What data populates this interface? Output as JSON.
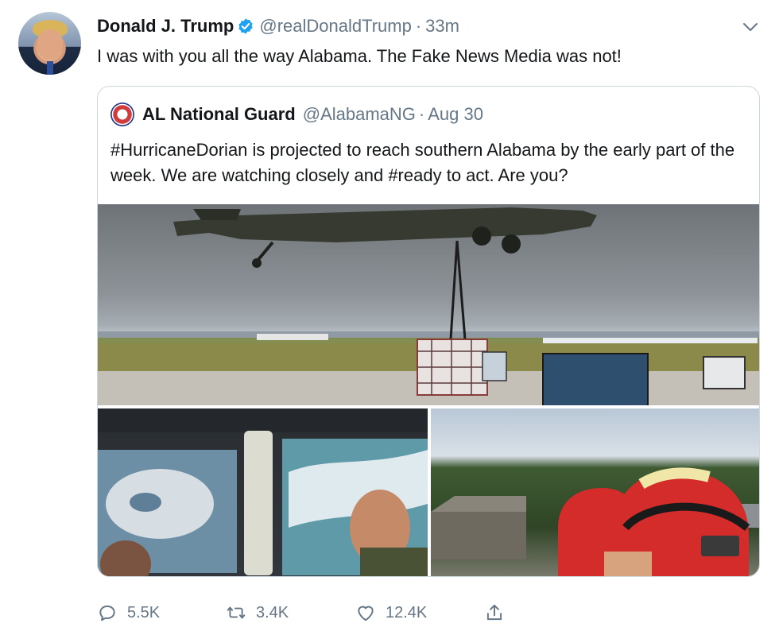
{
  "tweet": {
    "author_name": "Donald J. Trump",
    "handle": "@realDonaldTrump",
    "separator": "·",
    "time": "33m",
    "text": "I was with you all the way Alabama. The Fake News Media was not!"
  },
  "quoted_tweet": {
    "author_name": "AL National Guard",
    "handle": "@AlabamaNG",
    "separator": "·",
    "time": "Aug 30",
    "text": "#HurricaneDorian is projected to reach southern Alabama by the early part of the week. We are watching closely and #ready to act. Are you?"
  },
  "actions": {
    "reply_count": "5.5K",
    "retweet_count": "3.4K",
    "like_count": "12.4K"
  },
  "icons": {
    "verified": "verified-badge-icon",
    "menu": "chevron-down-icon",
    "reply": "reply-icon",
    "retweet": "retweet-icon",
    "like": "heart-icon",
    "share": "share-icon"
  },
  "colors": {
    "verified_blue": "#1da1f2",
    "secondary_text": "#657786",
    "border": "#ccd6dd",
    "helmet_red": "#d42b2b"
  }
}
